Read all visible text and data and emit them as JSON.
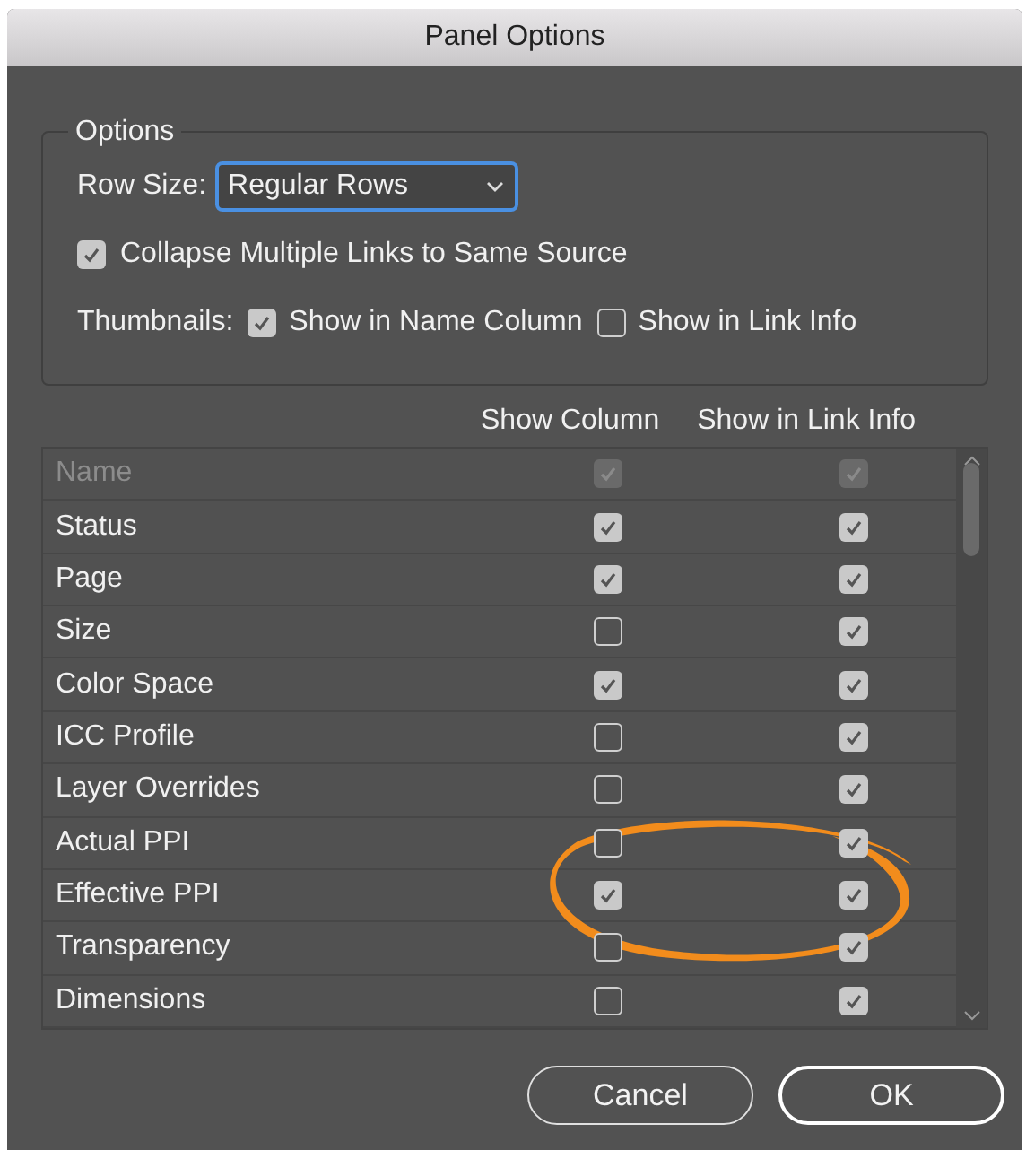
{
  "window": {
    "title": "Panel Options"
  },
  "options": {
    "legend": "Options",
    "row_size": {
      "label": "Row Size:",
      "value": "Regular Rows"
    },
    "collapse": {
      "label": "Collapse Multiple Links to Same Source",
      "checked": true
    },
    "thumbnails": {
      "label": "Thumbnails:",
      "items": [
        {
          "label": "Show in Name Column",
          "checked": true
        },
        {
          "label": "Show in Link Info",
          "checked": false
        }
      ]
    }
  },
  "table": {
    "columns": [
      "Show Column",
      "Show in Link Info"
    ],
    "rows": [
      {
        "name": "Name",
        "disabled": true,
        "show_column": true,
        "show_in_link_info": true
      },
      {
        "name": "Status",
        "disabled": false,
        "show_column": true,
        "show_in_link_info": true
      },
      {
        "name": "Page",
        "disabled": false,
        "show_column": true,
        "show_in_link_info": true
      },
      {
        "name": "Size",
        "disabled": false,
        "show_column": false,
        "show_in_link_info": true
      },
      {
        "name": "Color Space",
        "disabled": false,
        "show_column": true,
        "show_in_link_info": true
      },
      {
        "name": "ICC Profile",
        "disabled": false,
        "show_column": false,
        "show_in_link_info": true
      },
      {
        "name": "Layer Overrides",
        "disabled": false,
        "show_column": false,
        "show_in_link_info": true
      },
      {
        "name": "Actual PPI",
        "disabled": false,
        "show_column": false,
        "show_in_link_info": true
      },
      {
        "name": "Effective PPI",
        "disabled": false,
        "show_column": true,
        "show_in_link_info": true
      },
      {
        "name": "Transparency",
        "disabled": false,
        "show_column": false,
        "show_in_link_info": true
      },
      {
        "name": "Dimensions",
        "disabled": false,
        "show_column": false,
        "show_in_link_info": true
      }
    ]
  },
  "buttons": [
    {
      "label": "Cancel",
      "default": false
    },
    {
      "label": "OK",
      "default": true
    }
  ]
}
